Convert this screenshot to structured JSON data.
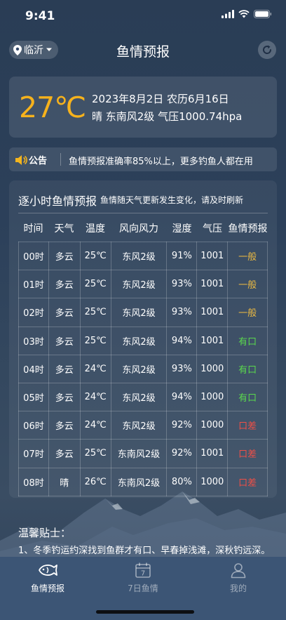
{
  "status_bar": {
    "time": "9:41"
  },
  "header": {
    "city": "临沂",
    "title": "鱼情预报",
    "icons": {
      "location": "location-pin-icon",
      "dropdown": "caret-down-icon",
      "refresh": "refresh-icon"
    }
  },
  "weather": {
    "temperature": "27℃",
    "date_line": "2023年8月2日 农历6月16日",
    "condition_line": "晴 东南风2级 气压1000.74hpa",
    "temp_color": "#f6b21c"
  },
  "notice": {
    "tag": "公告",
    "text": "鱼情预报准确率85%以上，更多钓鱼人都在用",
    "icon": "speaker-icon"
  },
  "hourly": {
    "title": "逐小时鱼情预报",
    "subtitle": "鱼情随天气更新发生变化，请及时刷新",
    "columns": [
      "时间",
      "天气",
      "温度",
      "风向风力",
      "湿度",
      "气压",
      "鱼情预报"
    ],
    "rows": [
      {
        "time": "00时",
        "weather": "多云",
        "temp": "25℃",
        "wind": "东风2级",
        "humidity": "91%",
        "pressure": "1001",
        "forecast": "一般",
        "level": "general"
      },
      {
        "time": "01时",
        "weather": "多云",
        "temp": "25℃",
        "wind": "东风2级",
        "humidity": "93%",
        "pressure": "1001",
        "forecast": "一般",
        "level": "general"
      },
      {
        "time": "02时",
        "weather": "多云",
        "temp": "25℃",
        "wind": "东风2级",
        "humidity": "93%",
        "pressure": "1001",
        "forecast": "一般",
        "level": "general"
      },
      {
        "time": "03时",
        "weather": "多云",
        "temp": "25℃",
        "wind": "东风2级",
        "humidity": "94%",
        "pressure": "1001",
        "forecast": "有口",
        "level": "good"
      },
      {
        "time": "04时",
        "weather": "多云",
        "temp": "24℃",
        "wind": "东风2级",
        "humidity": "93%",
        "pressure": "1000",
        "forecast": "有口",
        "level": "good"
      },
      {
        "time": "05时",
        "weather": "多云",
        "temp": "24℃",
        "wind": "东风2级",
        "humidity": "94%",
        "pressure": "1000",
        "forecast": "有口",
        "level": "good"
      },
      {
        "time": "06时",
        "weather": "多云",
        "temp": "24℃",
        "wind": "东风2级",
        "humidity": "92%",
        "pressure": "1000",
        "forecast": "口差",
        "level": "bad"
      },
      {
        "time": "07时",
        "weather": "多云",
        "temp": "25℃",
        "wind": "东南风2级",
        "humidity": "92%",
        "pressure": "1001",
        "forecast": "口差",
        "level": "bad"
      },
      {
        "time": "08时",
        "weather": "晴",
        "temp": "26℃",
        "wind": "东南风2级",
        "humidity": "80%",
        "pressure": "1000",
        "forecast": "口差",
        "level": "bad"
      }
    ],
    "level_colors": {
      "general": "#e9b842",
      "good": "#5ad84d",
      "bad": "#ef4f47"
    }
  },
  "tips": {
    "title": "温馨贴士：",
    "text": "1、冬季钓运约深找到鱼群才有口、早春掉浅滩，深秋钓远深。"
  },
  "tabbar": {
    "tabs": [
      {
        "label": "鱼情预报",
        "icon": "fish-icon",
        "active": true
      },
      {
        "label": "7日鱼情",
        "icon": "calendar-7-icon",
        "icon_text": "7",
        "active": false
      },
      {
        "label": "我的",
        "icon": "person-icon",
        "active": false
      }
    ]
  }
}
